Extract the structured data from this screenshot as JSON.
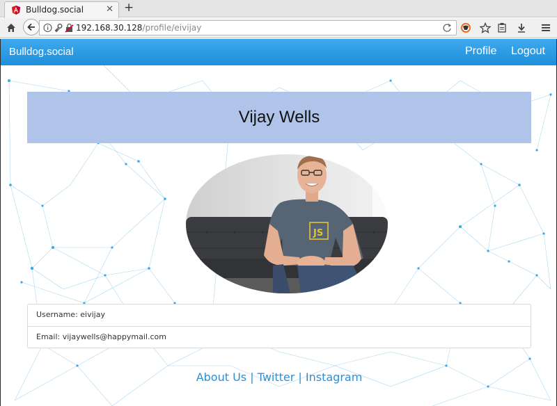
{
  "browser": {
    "tab_title": "Bulldog.social",
    "url_host": "192.168.30.128",
    "url_path": "/profile/eivijay"
  },
  "nav": {
    "brand": "Bulldog.social",
    "profile": "Profile",
    "logout": "Logout",
    "color": "#1d8fdc"
  },
  "profile": {
    "name": "Vijay Wells",
    "username_label": "Username: eivijay",
    "email_label": "Email: vijaywells@happymail.com",
    "banner_color": "#b0c4e9"
  },
  "footer": {
    "about": "About Us",
    "sep1": " | ",
    "twitter": "Twitter",
    "sep2": " | ",
    "instagram": "Instagram"
  }
}
